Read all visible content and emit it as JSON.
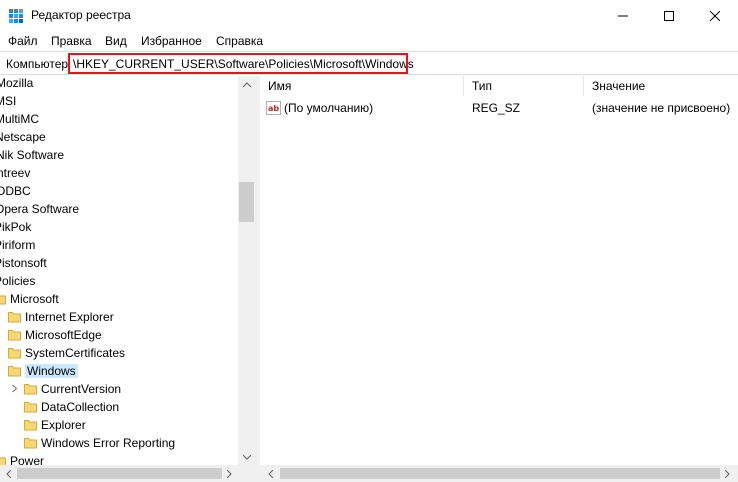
{
  "window": {
    "title": "Редактор реестра"
  },
  "menu": [
    "Файл",
    "Правка",
    "Вид",
    "Избранное",
    "Справка"
  ],
  "address": {
    "prefix": "Компьютер",
    "path": "\\HKEY_CURRENT_USER\\Software\\Policies\\Microsoft\\Windows"
  },
  "tree": {
    "items": [
      "Mozilla",
      "MSI",
      "MultiMC",
      "Netscape",
      "Nik Software",
      "ntreev",
      "ODBC",
      "Opera Software",
      "PikPok",
      "Piriform",
      "Pistonsoft",
      "Policies",
      "Microsoft",
      "Internet Explorer",
      "MicrosoftEdge",
      "SystemCertificates",
      "Windows",
      "CurrentVersion",
      "DataCollection",
      "Explorer",
      "Windows Error Reporting",
      "Power"
    ],
    "selected": "Windows"
  },
  "list": {
    "columns": {
      "name": "Имя",
      "type": "Тип",
      "value": "Значение"
    },
    "rows": [
      {
        "name": "(По умолчанию)",
        "type": "REG_SZ",
        "value": "(значение не присвоено)"
      }
    ]
  },
  "colors": {
    "selection": "#cce8ff",
    "highlight_border": "#e81123",
    "folder": "#f8d775"
  }
}
